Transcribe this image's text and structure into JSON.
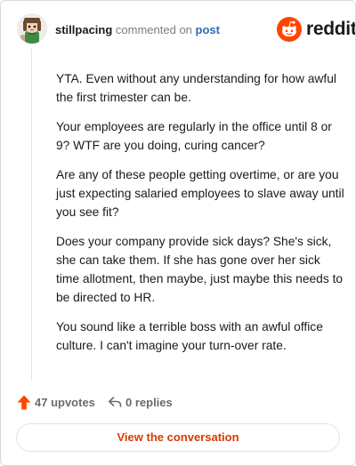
{
  "comment": {
    "author": "stillpacing",
    "verb": "commented on",
    "link_text": "post",
    "paragraphs": [
      "YTA. Even without any understanding for how awful the first trimester can be.",
      "Your employees are regularly in the office until 8 or 9? WTF are you doing, curing cancer?",
      "Are any of these people getting overtime, or are you just expecting salaried employees to slave away until you see fit?",
      "Does your company provide sick days? She's sick, she can take them. If she has gone over her sick time allotment, then maybe, just maybe this needs to be directed to HR.",
      "You sound like a terrible boss with an awful office culture. I can't imagine your turn-over rate."
    ]
  },
  "brand": {
    "name": "reddit",
    "icon": "reddit-alien-logo",
    "color": "#ff4500"
  },
  "actions": {
    "upvotes": "47 upvotes",
    "upvote_icon": "upvote-arrow-icon",
    "upvote_color": "#ff4500",
    "replies": "0 replies",
    "reply_icon": "reply-arrow-icon"
  },
  "cta": {
    "label": "View the conversation",
    "color": "#d93a00"
  },
  "avatar": {
    "icon": "snoo-avatar"
  }
}
